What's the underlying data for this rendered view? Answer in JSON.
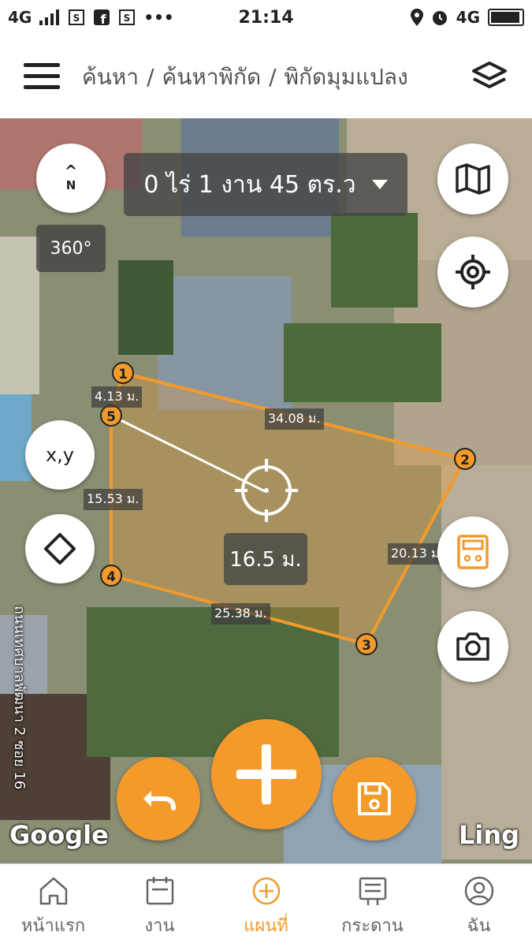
{
  "status_bar": {
    "network_left": "4G",
    "time": "21:14",
    "network_right": "4G",
    "icons": [
      "signal-icon",
      "sim-icon",
      "facebook-icon",
      "sim-icon",
      "more-icon",
      "location-icon",
      "alarm-icon",
      "battery-icon"
    ],
    "more": "•••"
  },
  "header": {
    "breadcrumb": [
      "ค้นหา",
      "ค้นหาพิกัด",
      "พิกัดมุมแปลง"
    ],
    "separator": "/"
  },
  "map": {
    "compass": {
      "arrow": "^",
      "letter": "N"
    },
    "rotation": "360°",
    "area": "0 ไร่ 1 งาน 45 ตร.ว",
    "xy_label": "x,y",
    "center_distance": "16.5 ม.",
    "road_name": "ถนนเทศบาลพัฒนา 2 ซอย 16",
    "google_logo": "Google",
    "ling_logo": "Ling",
    "points": [
      "1",
      "2",
      "3",
      "4",
      "5"
    ],
    "edges": [
      {
        "id": "1-2",
        "label": "34.08 ม."
      },
      {
        "id": "2-3",
        "label": "20.13 ม."
      },
      {
        "id": "3-4",
        "label": "25.38 ม."
      },
      {
        "id": "4-5",
        "label": "15.53 ม."
      },
      {
        "id": "5-1",
        "label": "4.13 ม."
      }
    ],
    "colors": {
      "accent": "#f39a2b",
      "polygon_fill": "rgba(243,154,43,0.25)"
    }
  },
  "bottom_nav": {
    "items": [
      {
        "label": "หน้าแรก",
        "icon": "home-icon",
        "active": false
      },
      {
        "label": "งาน",
        "icon": "clipboard-icon",
        "active": false
      },
      {
        "label": "แผนที่",
        "icon": "add-circle-icon",
        "active": true
      },
      {
        "label": "กระดาน",
        "icon": "board-icon",
        "active": false
      },
      {
        "label": "ฉัน",
        "icon": "user-icon",
        "active": false
      }
    ],
    "active_color": "#f39a2b"
  }
}
